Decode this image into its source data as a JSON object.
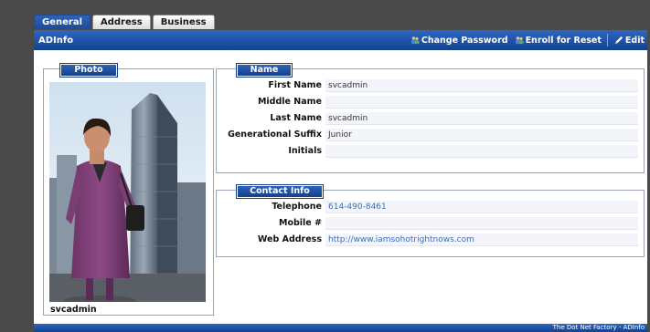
{
  "tabs": [
    {
      "label": "General",
      "active": true
    },
    {
      "label": "Address",
      "active": false
    },
    {
      "label": "Business",
      "active": false
    }
  ],
  "header": {
    "title": "ADInfo",
    "actions": [
      {
        "label": "Change Password",
        "icon": "users-icon"
      },
      {
        "label": "Enroll for Reset",
        "icon": "users-icon"
      },
      {
        "label": "Edit",
        "icon": "pencil-icon"
      }
    ]
  },
  "photo": {
    "legend": "Photo",
    "caption": "svcadmin"
  },
  "name_section": {
    "legend": "Name",
    "fields": [
      {
        "label": "First Name",
        "value": "svcadmin"
      },
      {
        "label": "Middle Name",
        "value": ""
      },
      {
        "label": "Last Name",
        "value": "svcadmin"
      },
      {
        "label": "Generational Suffix",
        "value": "Junior"
      },
      {
        "label": "Initials",
        "value": ""
      }
    ]
  },
  "contact_section": {
    "legend": "Contact Info",
    "fields": [
      {
        "label": "Telephone",
        "value": "614-490-8461"
      },
      {
        "label": "Mobile #",
        "value": ""
      },
      {
        "label": "Web Address",
        "value": "http://www.iamsohotrightnows.com"
      }
    ]
  },
  "footer": {
    "text": "The Dot Net Factory - ADInfo"
  },
  "colors": {
    "accent": "#1e4b96",
    "link": "#3a6fb5"
  }
}
